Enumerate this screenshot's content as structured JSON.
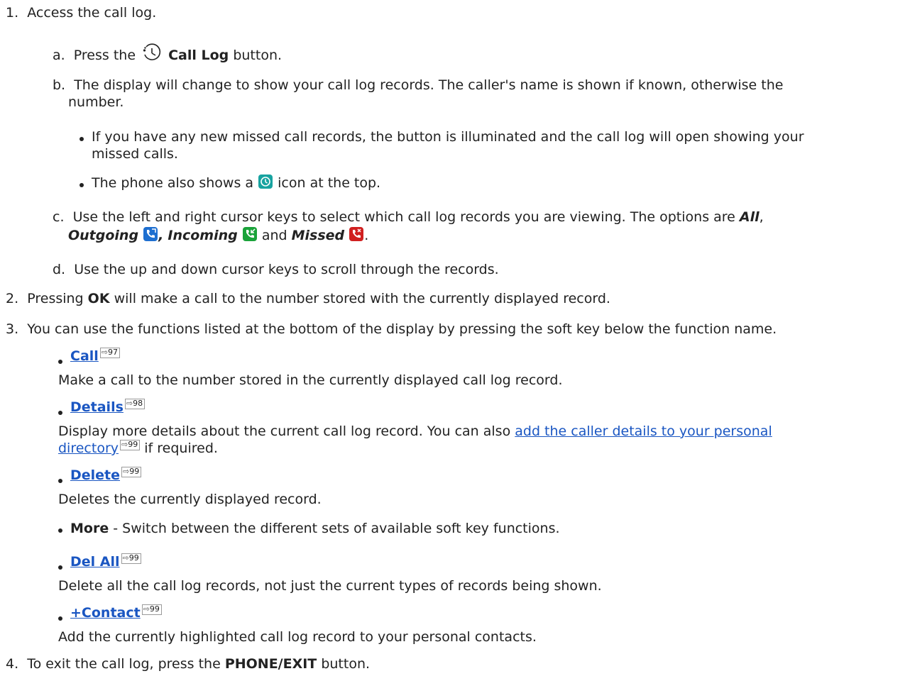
{
  "step1": {
    "num": "1.",
    "text": "Access the call log.",
    "a": {
      "num": "a.",
      "pre": "Press the",
      "bold": "Call Log",
      "post": "button."
    },
    "b": {
      "num": "b.",
      "line1": "The display will change to show your call log records. The caller's name is shown if known, otherwise the",
      "line2": "number.",
      "bullet1_line1": "If you have any new missed call records, the button is illuminated and the call log will open showing your",
      "bullet1_line2": "missed calls.",
      "bullet2_pre": "The phone also shows a",
      "bullet2_post": "icon at the top."
    },
    "c": {
      "num": "c.",
      "line1_pre": "Use the left and right cursor keys to select which call log records you are viewing. The options are",
      "all": "All",
      "comma1": ",",
      "outgoing": "Outgoing",
      "comma2": ",",
      "incoming": "Incoming",
      "and": "and",
      "missed": "Missed",
      "period": "."
    },
    "d": {
      "num": "d.",
      "text": "Use the up and down cursor keys to scroll through the records."
    }
  },
  "step2": {
    "num": "2.",
    "pre": "Pressing",
    "bold": "OK",
    "post": "will make a call to the number stored with the currently displayed record."
  },
  "step3": {
    "num": "3.",
    "text": "You can use the functions listed at the bottom of the display by pressing the soft key below the function name.",
    "items": [
      {
        "label": "Call",
        "page": "97",
        "desc": "Make a call to the number stored in the currently displayed call log record."
      },
      {
        "label": "Details",
        "page": "98",
        "desc_line1_pre": "Display more details about the current call log record. You can also",
        "link_line1": "add the caller details to your personal",
        "link_line2": "directory",
        "link_page": "99",
        "desc_line2_post": "if required."
      },
      {
        "label": "Delete",
        "page": "99",
        "desc": "Deletes the currently displayed record."
      },
      {
        "label": "More",
        "desc": "- Switch between the different sets of available soft key functions."
      },
      {
        "label": "Del All",
        "page": "99",
        "desc": "Delete all the call log records, not just the current types of records being shown."
      },
      {
        "label": "+Contact",
        "page": "99",
        "desc": "Add the currently highlighted call log record to your personal contacts."
      }
    ]
  },
  "step4": {
    "num": "4.",
    "pre": "To exit the call log, press the",
    "bold": "PHONE/EXIT",
    "post": "button."
  },
  "xref_arrow": "⇨",
  "colors": {
    "link": "#1a56c2",
    "text": "#222222",
    "missed_icon_bg": "#18a3a0",
    "outgoing_icon_bg": "#1e6fd0",
    "incoming_icon_bg": "#1aa33a",
    "missed_red_bg": "#d02020"
  }
}
